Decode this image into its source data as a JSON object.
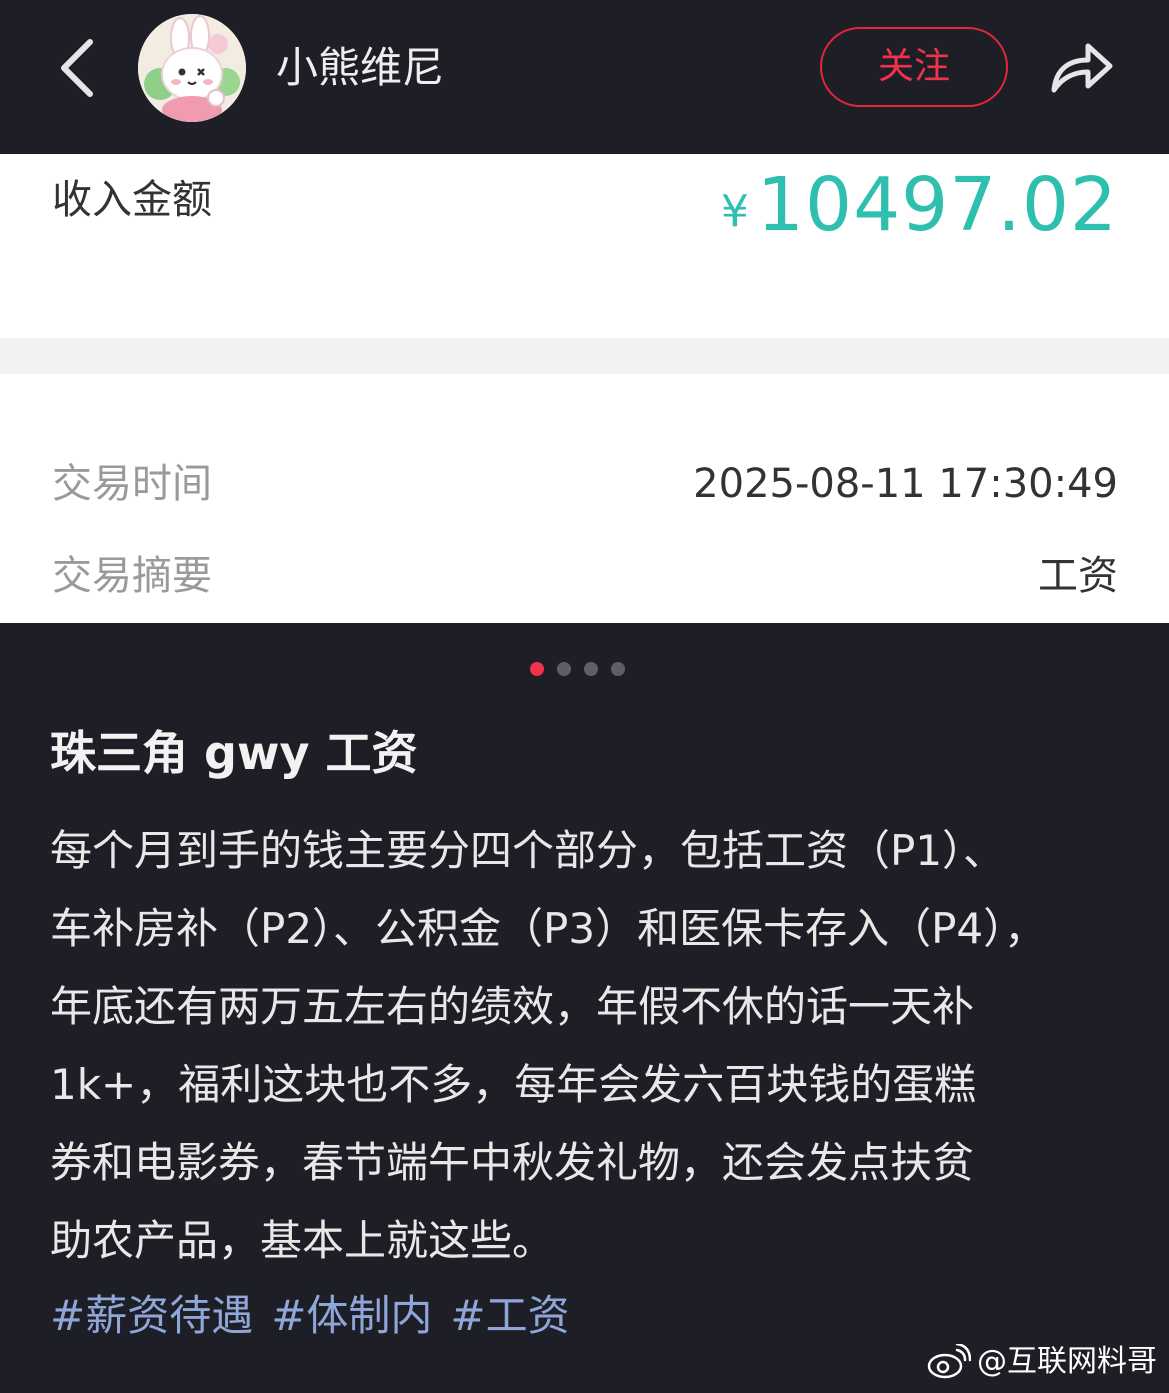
{
  "header": {
    "username": "小熊维尼",
    "follow_label": "关注"
  },
  "receipt": {
    "amount_label": "收入金额",
    "currency": "¥",
    "amount": "10497.02",
    "rows": [
      {
        "label": "交易时间",
        "value": "2025-08-11 17:30:49"
      },
      {
        "label": "交易摘要",
        "value": "工资"
      }
    ]
  },
  "carousel": {
    "count": 4,
    "active": 0
  },
  "post": {
    "title": "珠三角 gwy 工资",
    "lines": [
      "每个月到手的钱主要分四个部分，包括工资（P1）、",
      "车补房补（P2）、公积金（P3）和医保卡存入（P4），",
      "年底还有两万五左右的绩效，年假不休的话一天补",
      "1k+，福利这块也不多，每年会发六百块钱的蛋糕",
      "券和电影券，春节端午中秋发礼物，还会发点扶贫",
      "助农产品，基本上就这些。"
    ],
    "tags": [
      "#薪资待遇",
      "#体制内",
      "#工资"
    ]
  },
  "watermark": "@互联网料哥",
  "colors": {
    "background": "#1e1e26",
    "accent_red": "#f0334a",
    "amount_teal": "#2fbfae",
    "tag_blue": "#8fa6d8"
  },
  "icons": [
    "back-arrow-icon",
    "share-icon",
    "weibo-logo-icon"
  ]
}
